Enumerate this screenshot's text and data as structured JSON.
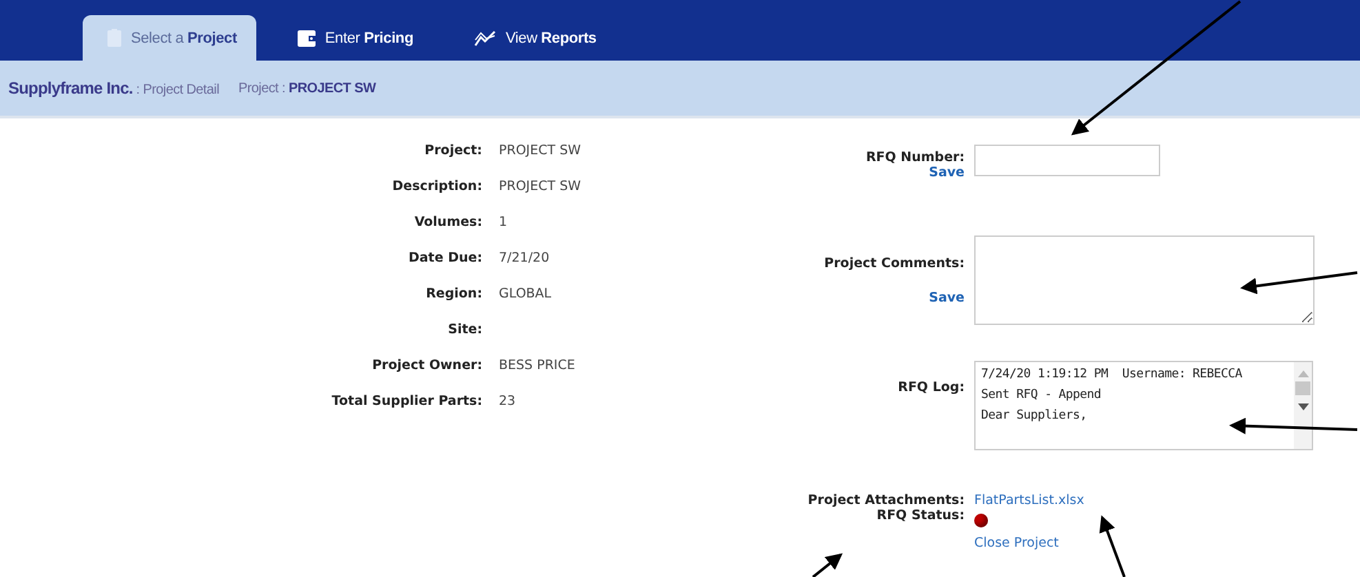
{
  "nav_tabs": [
    {
      "label": "Select a **Project**",
      "selected": true
    },
    {
      "label": "Enter **Pricing**",
      "selected": false
    },
    {
      "label": "View **Reports**",
      "selected": false
    }
  ],
  "breadcrumb": {
    "company": "Supplyframe Inc.",
    "page": " : Project Detail",
    "project": "Project : **PROJECT SW**"
  },
  "details": [
    {
      "label": "Project:",
      "value": "PROJECT SW"
    },
    {
      "label": "Description:",
      "value": "PROJECT SW"
    },
    {
      "label": "Volumes:",
      "value": "1"
    },
    {
      "label": "Date Due:",
      "value": "7/21/20"
    },
    {
      "label": "Region:",
      "value": "GLOBAL"
    },
    {
      "label": "Site:"
    },
    {
      "label": "Project Owner:",
      "value": "BESS PRICE"
    },
    {
      "label": "Total Supplier Parts:",
      "value": "23"
    }
  ],
  "rfq_number": {
    "label": "RFQ Number:",
    "save": "Save"
  },
  "project_comments": {
    "label": "Project Comments:",
    "save": "Save"
  },
  "rfq_log": {
    "label": "RFQ Log:",
    "value": "7/24/20 1:19:12 PM  Username: REBECCA\nSent RFQ - Append\nDear Suppliers,"
  },
  "attachments": {
    "label": "Project Attachments:",
    "file": "FlatPartsList.xlsx"
  },
  "rfq_status": {
    "label": "RFQ Status:",
    "color": "#c00000",
    "action": "Close Project"
  }
}
